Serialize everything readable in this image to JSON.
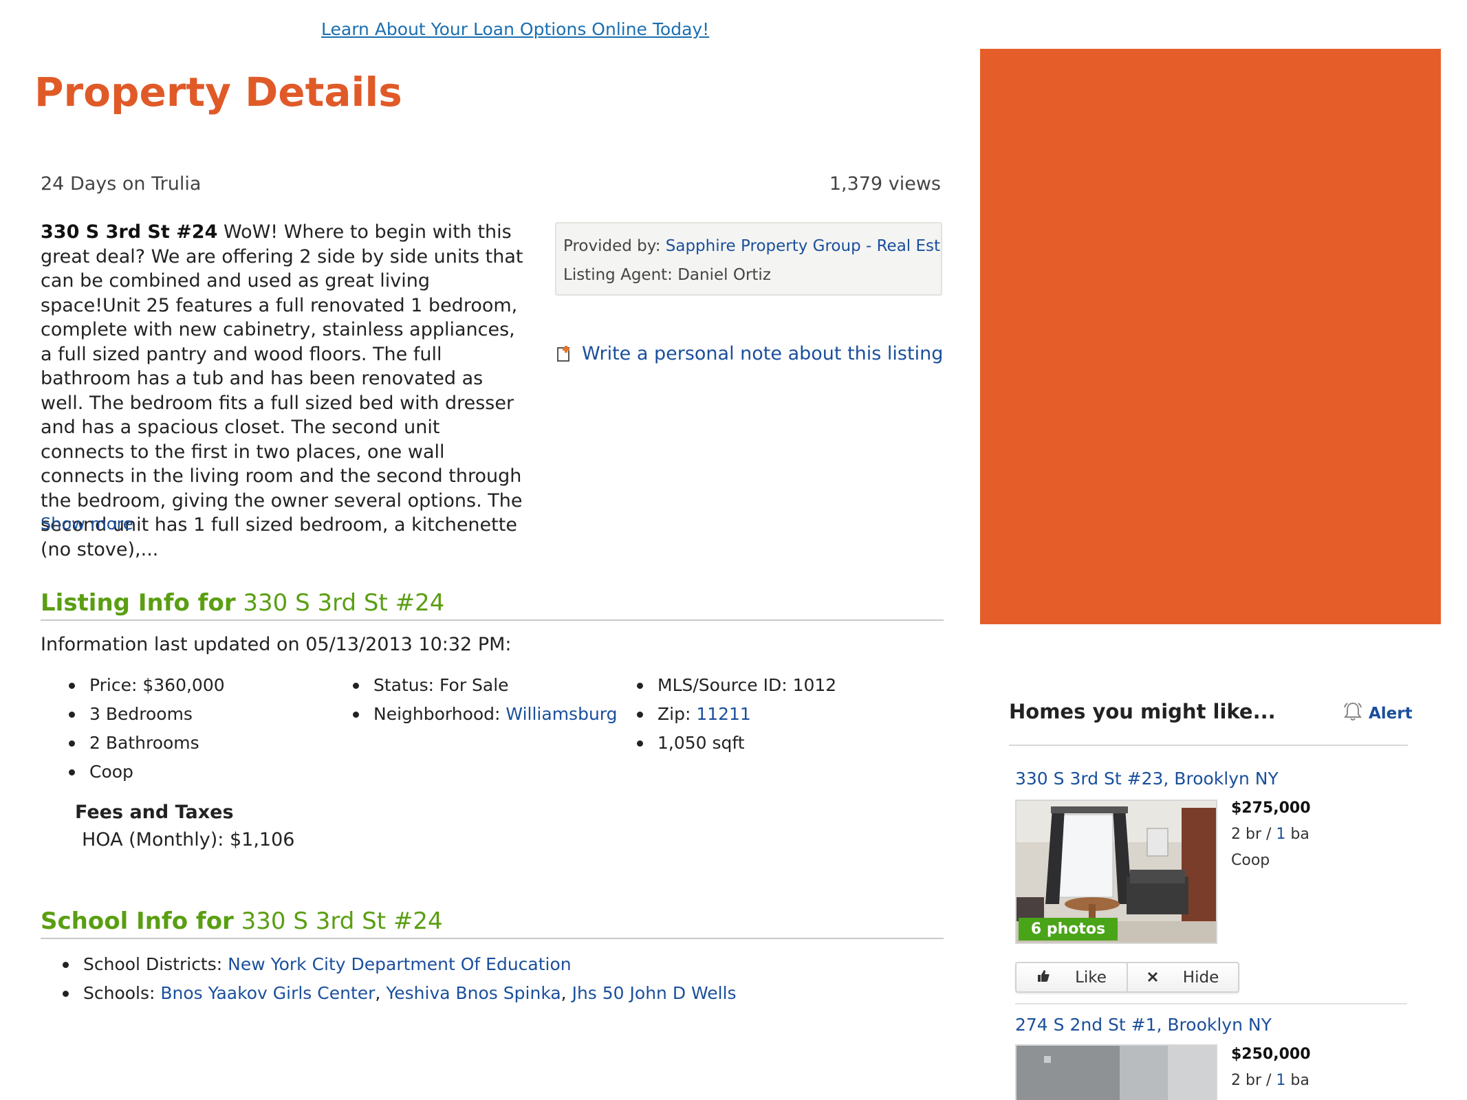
{
  "promo_link": "Learn About Your Loan Options Online Today!",
  "page_title": "Property Details",
  "days_on_site": "24 Days on Trulia",
  "views": "1,379 views",
  "description": {
    "address": "330 S 3rd St #24",
    "text": " WoW! Where to begin with this great deal? We are offering 2 side by side units that can be combined and used as great living space!Unit 25 features a full renovated 1 bedroom, complete with new cabinetry, stainless appliances, a full sized pantry and wood floors. The full bathroom has a tub and has been renovated as well. The bedroom fits a full sized bed with dresser and has a spacious closet. The second unit connects to the first in two places, one wall connects in the living room and the second through the bedroom, giving the owner several options. The second unit has 1 full sized bedroom, a kitchenette (no stove),...",
    "show_more": "Show more"
  },
  "provider": {
    "label": "Provided by: ",
    "name": "Sapphire Property Group - Real Estate",
    "agent": "Listing Agent: Daniel Ortiz"
  },
  "note_link": "Write a personal note about this listing",
  "listing_info": {
    "heading": "Listing Info for",
    "address": "330 S 3rd St #24",
    "updated": "Information last updated on 05/13/2013 10:32 PM:",
    "col1": [
      "Price: $360,000",
      "3 Bedrooms",
      "2 Bathrooms",
      "Coop"
    ],
    "status": "Status: For Sale",
    "neighborhood_label": "Neighborhood: ",
    "neighborhood": "Williamsburg",
    "mls": "MLS/Source ID: 1012",
    "zip_label": "Zip: ",
    "zip": "11211",
    "sqft": "1,050 sqft",
    "fees_title": "Fees and Taxes",
    "hoa": "HOA (Monthly): $1,106"
  },
  "school_info": {
    "heading": "School Info for",
    "address": "330 S 3rd St #24",
    "districts_label": "School Districts: ",
    "district": "New York City Department Of Education",
    "schools_label": "Schools: ",
    "schools": [
      "Bnos Yaakov Girls Center",
      "Yeshiva Bnos Spinka",
      "Jhs 50 John D Wells"
    ],
    "separator": ", "
  },
  "homes": {
    "title": "Homes you might like...",
    "alert": "Alert",
    "listings": [
      {
        "address": "330 S 3rd St #23, Brooklyn NY",
        "price": "$275,000",
        "br": "2",
        "br_unit": " br",
        "slash": " / ",
        "ba": "1",
        "ba_unit": " ba",
        "type": "Coop",
        "photos": "6 photos",
        "like": "Like",
        "hide": "Hide"
      },
      {
        "address": "274 S 2nd St #1, Brooklyn NY",
        "price": "$250,000",
        "br": "2",
        "br_unit": " br",
        "slash": " / ",
        "ba": "1",
        "ba_unit": " ba"
      }
    ]
  },
  "colors": {
    "title": "#e05a28",
    "section_green": "#5a9e12",
    "link_blue": "#1a4f9c",
    "ad_orange": "#e55e2a",
    "photo_badge": "#4aa417"
  }
}
